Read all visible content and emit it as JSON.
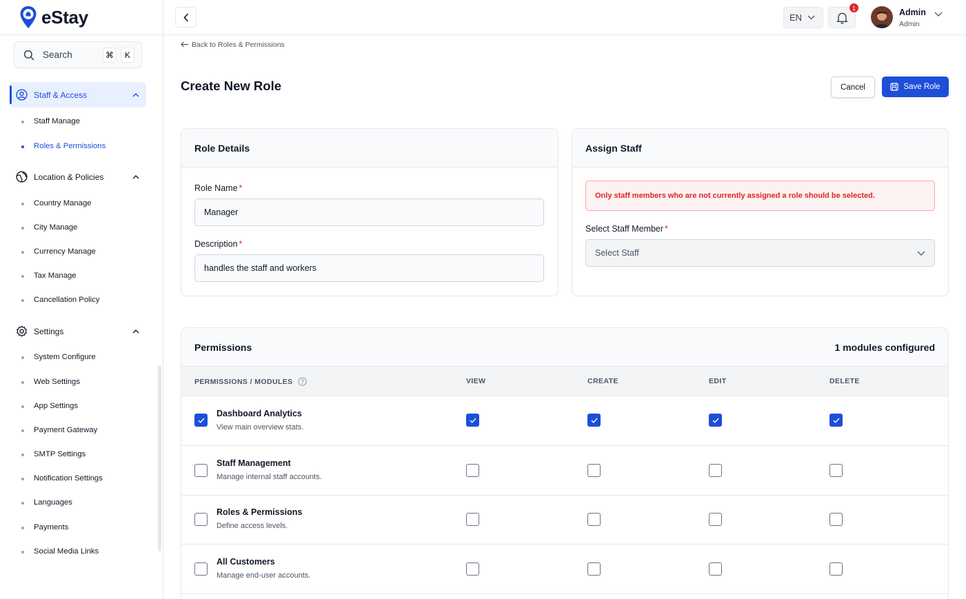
{
  "brand": {
    "name": "eStay",
    "color": "#1d4ed8"
  },
  "search": {
    "label": "Search",
    "kbd_cmd": "⌘",
    "kbd_key": "K"
  },
  "sidebar": {
    "groups": [
      {
        "label": "Staff & Access",
        "icon": "user-circle-icon",
        "active": true,
        "items": [
          {
            "label": "Staff Manage"
          },
          {
            "label": "Roles & Permissions",
            "active": true
          }
        ]
      },
      {
        "label": "Location & Policies",
        "icon": "globe-icon",
        "items": [
          {
            "label": "Country Manage"
          },
          {
            "label": "City Manage"
          },
          {
            "label": "Currency Manage"
          },
          {
            "label": "Tax Manage"
          },
          {
            "label": "Cancellation Policy"
          }
        ]
      },
      {
        "label": "Settings",
        "icon": "gear-icon",
        "items": [
          {
            "label": "System Configure"
          },
          {
            "label": "Web Settings"
          },
          {
            "label": "App Settings"
          },
          {
            "label": "Payment Gateway"
          },
          {
            "label": "SMTP Settings"
          },
          {
            "label": "Notification Settings"
          },
          {
            "label": "Languages"
          },
          {
            "label": "Payments"
          },
          {
            "label": "Social Media Links"
          }
        ]
      }
    ]
  },
  "topbar": {
    "language": "EN",
    "notification_count": "1",
    "user": {
      "name": "Admin",
      "role": "Admin"
    }
  },
  "breadcrumb": "Back to Roles & Permissions",
  "page": {
    "title": "Create New Role",
    "cancel_label": "Cancel",
    "save_label": "Save Role"
  },
  "role_details": {
    "title": "Role Details",
    "name_label": "Role Name",
    "name_value": "Manager",
    "description_label": "Description",
    "description_value": "handles the staff and workers"
  },
  "assign_staff": {
    "title": "Assign Staff",
    "alert": "Only staff members who are not currently assigned a role should be selected.",
    "select_label": "Select Staff Member",
    "select_placeholder": "Select Staff"
  },
  "permissions": {
    "title": "Permissions",
    "configured": "1 modules configured",
    "columns": [
      "PERMISSIONS / MODULES",
      "VIEW",
      "CREATE",
      "EDIT",
      "DELETE"
    ],
    "rows": [
      {
        "name": "Dashboard Analytics",
        "desc": "View main overview stats.",
        "all": true,
        "view": true,
        "create": true,
        "edit": true,
        "delete": true
      },
      {
        "name": "Staff Management",
        "desc": "Manage internal staff accounts.",
        "all": false,
        "view": false,
        "create": false,
        "edit": false,
        "delete": false
      },
      {
        "name": "Roles & Permissions",
        "desc": "Define access levels.",
        "all": false,
        "view": false,
        "create": false,
        "edit": false,
        "delete": false
      },
      {
        "name": "All Customers",
        "desc": "Manage end-user accounts.",
        "all": false,
        "view": false,
        "create": false,
        "edit": false,
        "delete": false
      }
    ]
  }
}
